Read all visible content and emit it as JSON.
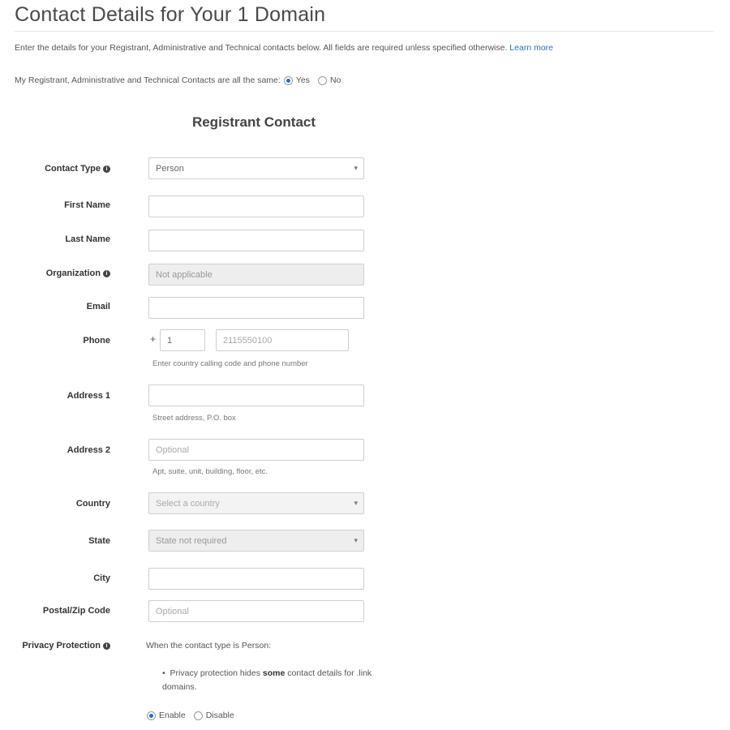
{
  "page": {
    "title": "Contact Details for Your 1 Domain",
    "intro": "Enter the details for your Registrant, Administrative and Technical contacts below. All fields are required unless specified otherwise.",
    "learn_more": "Learn more",
    "same_contacts_label": "My Registrant, Administrative and Technical Contacts are all the same:",
    "same_yes": "Yes",
    "same_no": "No"
  },
  "registrant": {
    "title": "Registrant Contact",
    "contact_type_label": "Contact Type",
    "contact_type_value": "Person",
    "first_name_label": "First Name",
    "last_name_label": "Last Name",
    "organization_label": "Organization",
    "organization_placeholder": "Not applicable",
    "email_label": "Email",
    "phone_label": "Phone",
    "phone_plus": "+",
    "phone_code": "1",
    "phone_number_placeholder": "2115550100",
    "phone_help": "Enter country calling code and phone number",
    "address1_label": "Address 1",
    "address1_help": "Street address, P.O. box",
    "address2_label": "Address 2",
    "address2_placeholder": "Optional",
    "address2_help": "Apt, suite, unit, building, floor, etc.",
    "country_label": "Country",
    "country_placeholder": "Select a country",
    "state_label": "State",
    "state_placeholder": "State not required",
    "city_label": "City",
    "postal_label": "Postal/Zip Code",
    "postal_placeholder": "Optional",
    "privacy_label": "Privacy Protection",
    "privacy_text": "When the contact type is Person:",
    "privacy_bullet_pre": "Privacy protection hides",
    "privacy_bullet_bold": "some",
    "privacy_bullet_post": "contact details for .link domains.",
    "enable_label": "Enable",
    "disable_label": "Disable"
  },
  "colors": {
    "accent": "#1f6fd1",
    "link": "#2a6fbf"
  },
  "icons": {
    "info": "info-circle-icon",
    "dropdown": "chevron-down-icon"
  }
}
